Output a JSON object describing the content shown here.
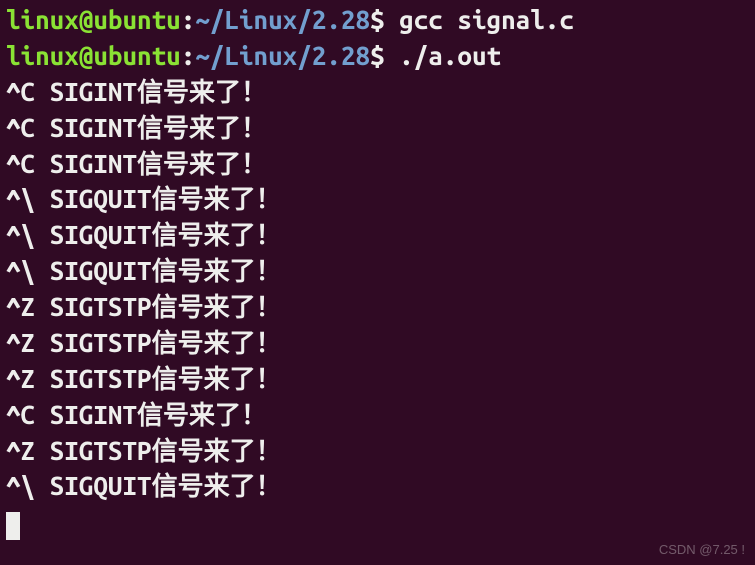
{
  "prompt": {
    "user": "linux",
    "at": "@",
    "host": "ubuntu",
    "colon": ":",
    "path": "~/Linux/2.28",
    "symbol": "$"
  },
  "commands": [
    "gcc signal.c",
    "./a.out"
  ],
  "outputs": [
    "^C SIGINT信号来了！",
    "^C SIGINT信号来了！",
    "^C SIGINT信号来了！",
    "^\\ SIGQUIT信号来了！",
    "^\\ SIGQUIT信号来了！",
    "^\\ SIGQUIT信号来了！",
    "^Z SIGTSTP信号来了！",
    "^Z SIGTSTP信号来了！",
    "^Z SIGTSTP信号来了！",
    "^C SIGINT信号来了！",
    "^Z SIGTSTP信号来了！",
    "^\\ SIGQUIT信号来了！"
  ],
  "watermark": "CSDN @7.25 !"
}
